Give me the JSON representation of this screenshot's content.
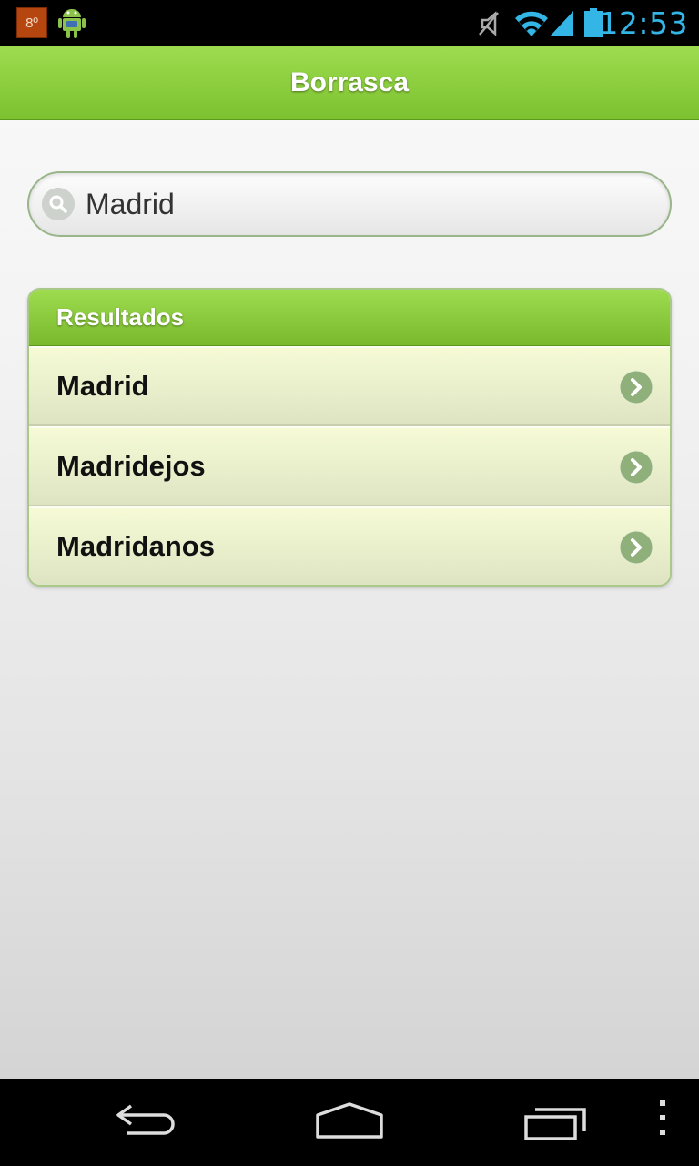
{
  "status_bar": {
    "temperature_badge": "8º",
    "time": "12:53",
    "icons": [
      "android-icon",
      "mute-icon",
      "wifi-icon",
      "signal-icon",
      "battery-icon"
    ]
  },
  "header": {
    "title": "Borrasca"
  },
  "search": {
    "value": "Madrid",
    "placeholder": "Madrid"
  },
  "results": {
    "title": "Resultados",
    "items": [
      {
        "label": "Madrid"
      },
      {
        "label": "Madridejos"
      },
      {
        "label": "Madridanos"
      }
    ]
  },
  "colors": {
    "header_green": "#8ccf3f",
    "status_blue": "#33b5e5",
    "item_bg": "#eef4cf",
    "chevron_bg": "#8fb07a"
  },
  "nav_bar": {
    "icons": [
      "back-icon",
      "home-icon",
      "recent-apps-icon",
      "overflow-menu-icon"
    ]
  }
}
